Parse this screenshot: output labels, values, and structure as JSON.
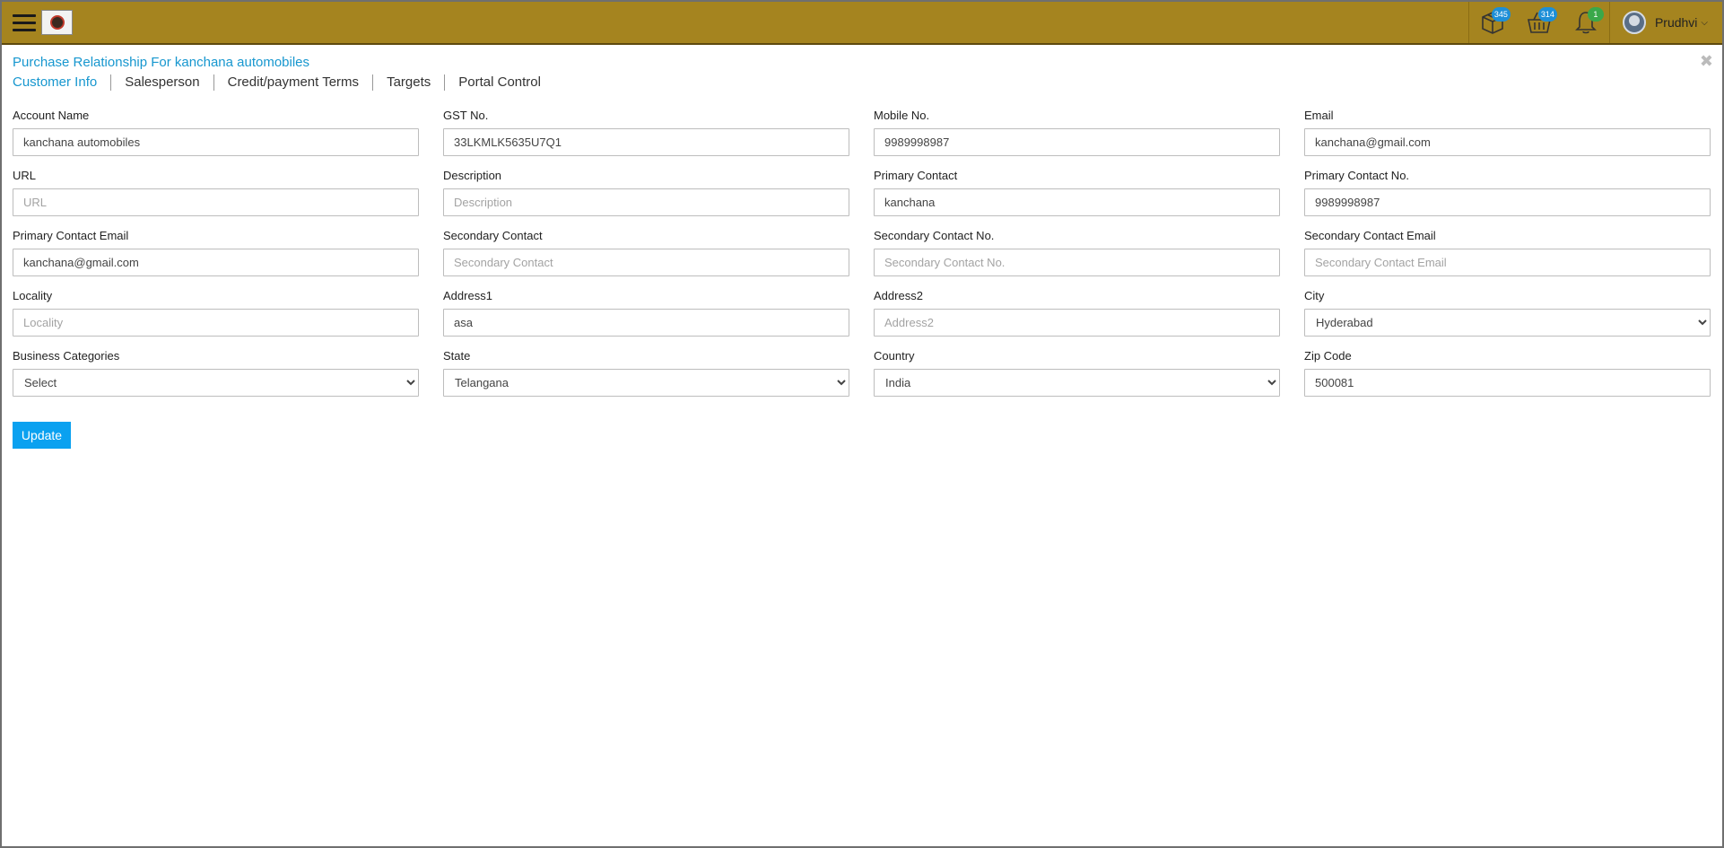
{
  "header": {
    "user_name": "Prudhvi",
    "badges": {
      "packages": "345",
      "basket": "314",
      "notifications": "1"
    },
    "colors": {
      "bar": "#a5841f",
      "accent": "#1797cf",
      "button": "#0aa1f0"
    }
  },
  "page": {
    "title": "Purchase Relationship For kanchana automobiles",
    "tabs": [
      "Customer Info",
      "Salesperson",
      "Credit/payment Terms",
      "Targets",
      "Portal Control"
    ],
    "active_tab": "Customer Info"
  },
  "form": {
    "account_name": {
      "label": "Account Name",
      "value": "kanchana automobiles",
      "placeholder": ""
    },
    "gst_no": {
      "label": "GST No.",
      "value": "33LKMLK5635U7Q1",
      "placeholder": ""
    },
    "mobile_no": {
      "label": "Mobile No.",
      "value": "9989998987",
      "placeholder": ""
    },
    "email": {
      "label": "Email",
      "value": "kanchana@gmail.com",
      "placeholder": ""
    },
    "url": {
      "label": "URL",
      "value": "",
      "placeholder": "URL"
    },
    "description": {
      "label": "Description",
      "value": "",
      "placeholder": "Description"
    },
    "primary_contact": {
      "label": "Primary Contact",
      "value": "kanchana",
      "placeholder": ""
    },
    "primary_contact_no": {
      "label": "Primary Contact No.",
      "value": "9989998987",
      "placeholder": ""
    },
    "primary_contact_email": {
      "label": "Primary Contact Email",
      "value": "kanchana@gmail.com",
      "placeholder": ""
    },
    "secondary_contact": {
      "label": "Secondary Contact",
      "value": "",
      "placeholder": "Secondary Contact"
    },
    "secondary_contact_no": {
      "label": "Secondary Contact No.",
      "value": "",
      "placeholder": "Secondary Contact No."
    },
    "secondary_contact_email": {
      "label": "Secondary Contact Email",
      "value": "",
      "placeholder": "Secondary Contact Email"
    },
    "locality": {
      "label": "Locality",
      "value": "",
      "placeholder": "Locality"
    },
    "address1": {
      "label": "Address1",
      "value": "asa",
      "placeholder": ""
    },
    "address2": {
      "label": "Address2",
      "value": "",
      "placeholder": "Address2"
    },
    "city": {
      "label": "City",
      "selected": "Hyderabad"
    },
    "business_categories": {
      "label": "Business Categories",
      "selected": "Select"
    },
    "state": {
      "label": "State",
      "selected": "Telangana"
    },
    "country": {
      "label": "Country",
      "selected": "India"
    },
    "zip_code": {
      "label": "Zip Code",
      "value": "500081",
      "placeholder": ""
    }
  },
  "actions": {
    "update_label": "Update"
  }
}
